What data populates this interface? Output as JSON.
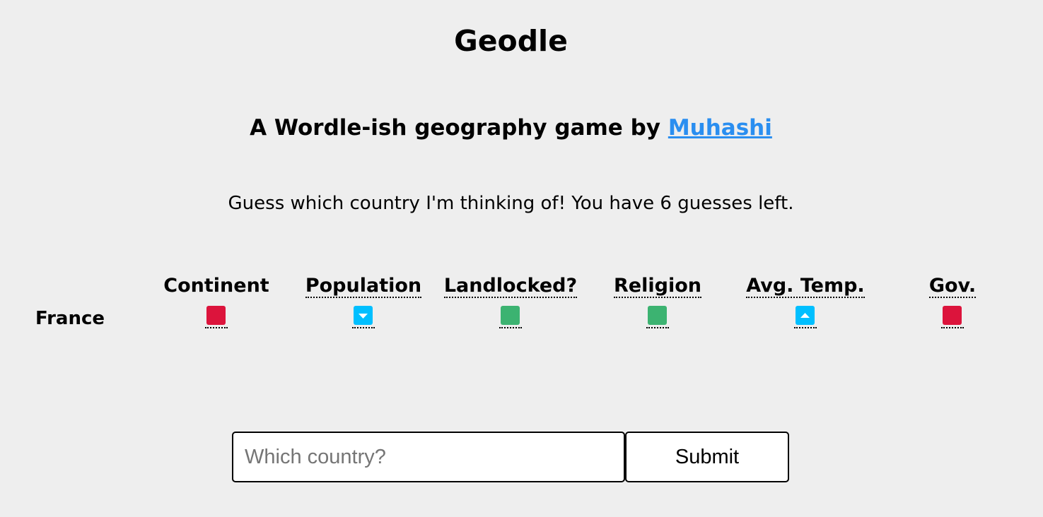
{
  "header": {
    "title": "Geodle",
    "subtitle_prefix": "A Wordle-ish geography game by ",
    "author_link": "Muhashi"
  },
  "instructions": "Guess which country I'm thinking of! You have 6 guesses left.",
  "columns": [
    {
      "label": "Continent"
    },
    {
      "label": "Population"
    },
    {
      "label": "Landlocked?"
    },
    {
      "label": "Religion"
    },
    {
      "label": "Avg. Temp."
    },
    {
      "label": "Gov."
    }
  ],
  "guesses": [
    {
      "country": "France",
      "results": [
        {
          "status": "wrong",
          "color": "#dc143c",
          "icon": null
        },
        {
          "status": "lower",
          "color": "#00bfff",
          "icon": "arrow-down-icon"
        },
        {
          "status": "correct",
          "color": "#3cb371",
          "icon": null
        },
        {
          "status": "correct",
          "color": "#3cb371",
          "icon": null
        },
        {
          "status": "higher",
          "color": "#00bfff",
          "icon": "arrow-up-icon"
        },
        {
          "status": "wrong",
          "color": "#dc143c",
          "icon": null
        }
      ]
    }
  ],
  "form": {
    "placeholder": "Which country?",
    "value": "",
    "submit_label": "Submit"
  },
  "colors": {
    "background": "#eeeeee",
    "link": "#2a8ef0",
    "wrong": "#dc143c",
    "correct": "#3cb371",
    "hint": "#00bfff"
  }
}
